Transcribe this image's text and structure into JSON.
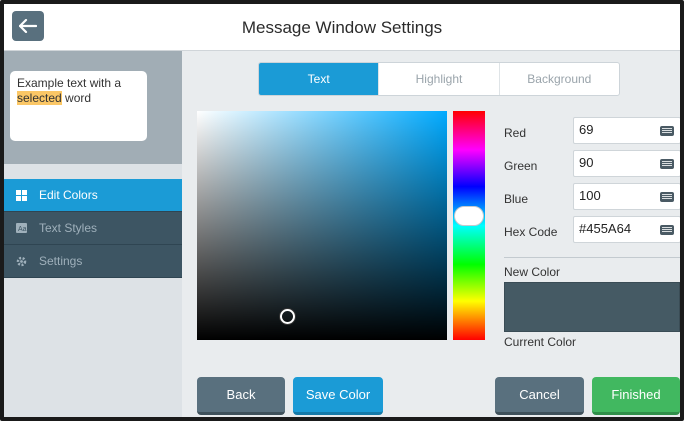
{
  "header": {
    "title": "Message Window Settings",
    "back_icon": "arrow-left-icon"
  },
  "preview": {
    "text_before": "Example text with a",
    "highlight": "selected",
    "text_after": " word",
    "highlight_color": "#FBC766"
  },
  "nav": {
    "items": [
      {
        "label": "Edit Colors",
        "icon": "grid-icon",
        "active": true
      },
      {
        "label": "Text Styles",
        "icon": "text-style-icon",
        "active": false
      },
      {
        "label": "Settings",
        "icon": "gear-icon",
        "active": false
      }
    ]
  },
  "tabs": [
    {
      "label": "Text",
      "active": true
    },
    {
      "label": "Highlight",
      "active": false
    },
    {
      "label": "Background",
      "active": false
    }
  ],
  "color": {
    "red_label": "Red",
    "red_value": "69",
    "green_label": "Green",
    "green_value": "90",
    "blue_label": "Blue",
    "blue_value": "100",
    "hex_label": "Hex Code",
    "hex_value": "#455A64",
    "new_color_label": "New Color",
    "current_color_label": "Current Color",
    "new_color_hex": "#455A64"
  },
  "buttons": {
    "back": "Back",
    "save": "Save Color",
    "cancel": "Cancel",
    "finished": "Finished"
  },
  "colors": {
    "accent": "#1B9BD6",
    "nav_bg": "#3D5563",
    "secondary": "#59707E",
    "success": "#41B860"
  }
}
